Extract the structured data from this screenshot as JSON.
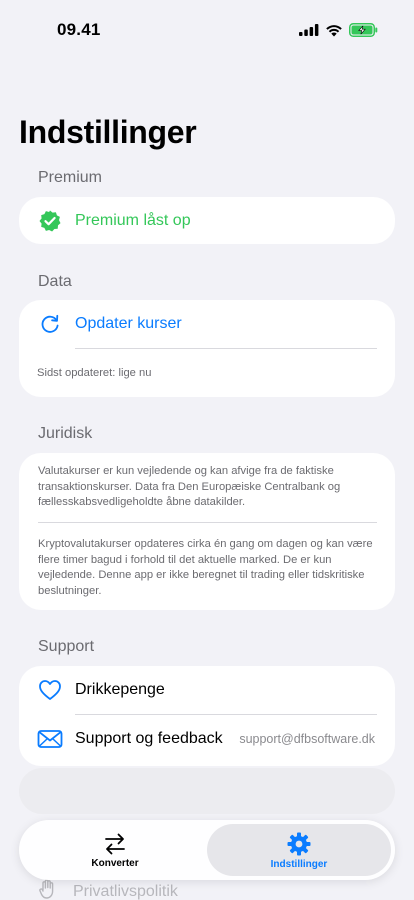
{
  "status": {
    "time": "09.41"
  },
  "title": "Indstillinger",
  "premium": {
    "header": "Premium",
    "label": "Premium låst op"
  },
  "data": {
    "header": "Data",
    "update_label": "Opdater kurser",
    "last_updated": "Sidst opdateret: lige nu"
  },
  "legal": {
    "header": "Juridisk",
    "paragraph1": "Valutakurser er kun vejledende og kan afvige fra de faktiske transaktionskurser. Data fra Den Europæiske Centralbank og fællesskabsvedligeholdte åbne datakilder.",
    "paragraph2": "Kryptovalutakurser opdateres cirka én gang om dagen og kan være flere timer bagud i forhold til det aktuelle marked. De er kun vejledende. Denne app er ikke beregnet til trading eller tidskritiske beslutninger."
  },
  "support": {
    "header": "Support",
    "tip_label": "Drikkepenge",
    "feedback_label": "Support og feedback",
    "feedback_email": "support@dfbsoftware.dk",
    "privacy_label": "Privatlivspolitik"
  },
  "tabs": [
    {
      "label": "Konverter",
      "icon": "arrows-swap-icon",
      "active": false
    },
    {
      "label": "Indstillinger",
      "icon": "gear-icon",
      "active": true
    }
  ],
  "colors": {
    "accent": "#0a7cff",
    "premium_green": "#34c759",
    "background": "#f2f2f7"
  }
}
